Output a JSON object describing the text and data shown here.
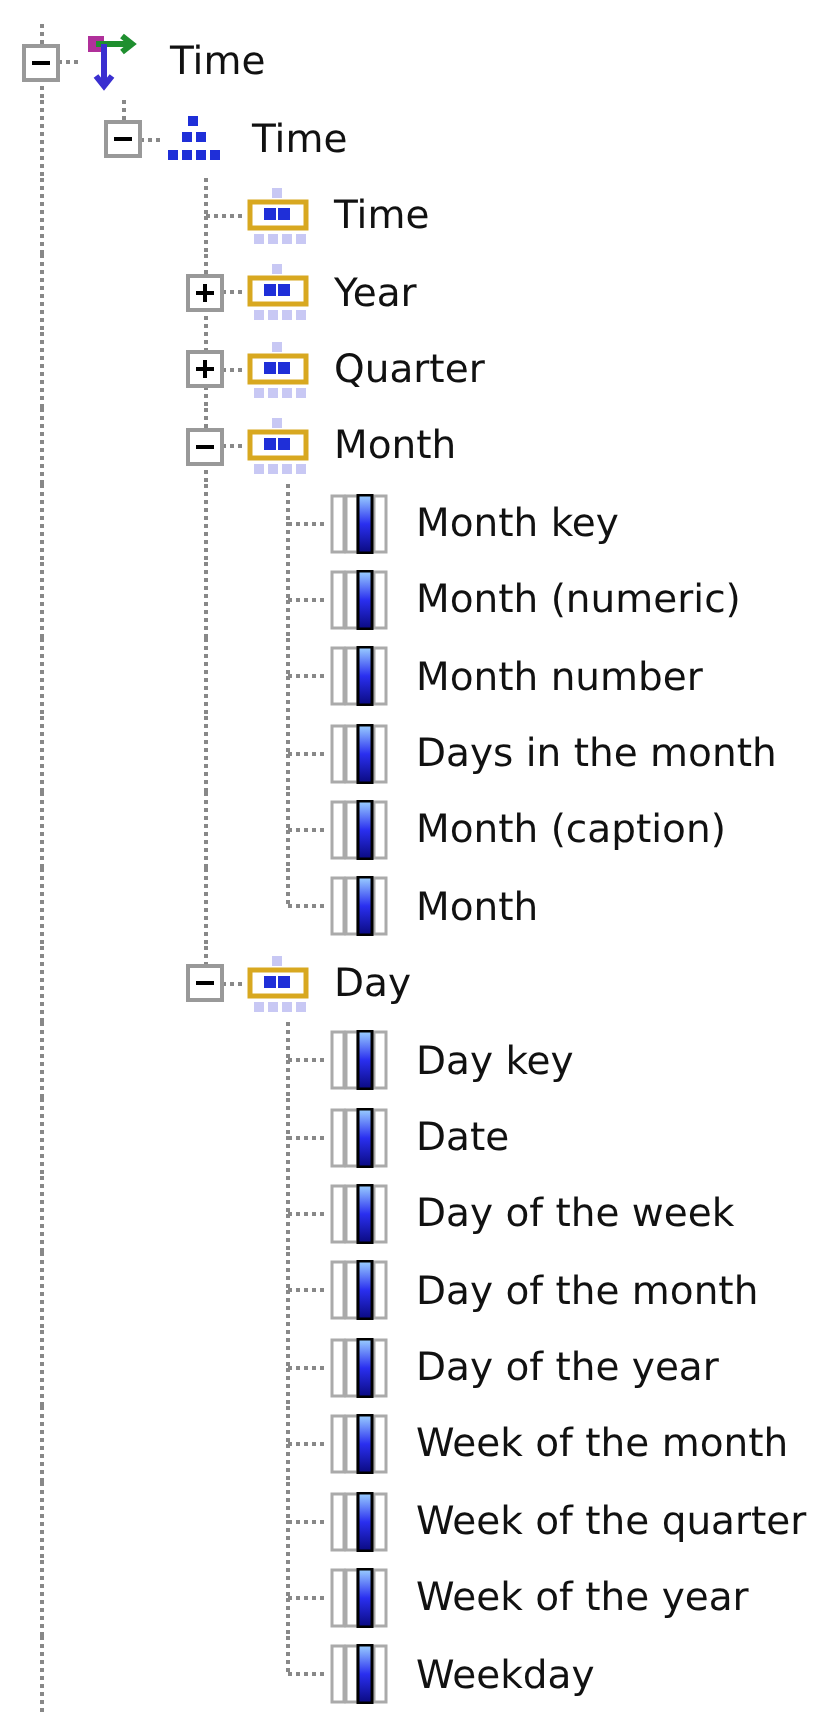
{
  "tree": [
    {
      "label": "Time",
      "kind": "dimension",
      "expanded": true,
      "children": [
        {
          "label": "Time",
          "kind": "hierarchy",
          "expanded": true,
          "children": [
            {
              "label": "Time",
              "kind": "level"
            },
            {
              "label": "Year",
              "kind": "level",
              "expanded": false
            },
            {
              "label": "Quarter",
              "kind": "level",
              "expanded": false
            },
            {
              "label": "Month",
              "kind": "level",
              "expanded": true,
              "children": [
                {
                  "label": "Month key",
                  "kind": "attribute"
                },
                {
                  "label": "Month (numeric)",
                  "kind": "attribute"
                },
                {
                  "label": "Month number",
                  "kind": "attribute"
                },
                {
                  "label": "Days in the month",
                  "kind": "attribute"
                },
                {
                  "label": "Month (caption)",
                  "kind": "attribute"
                },
                {
                  "label": "Month",
                  "kind": "attribute"
                }
              ]
            },
            {
              "label": "Day",
              "kind": "level",
              "expanded": true,
              "children": [
                {
                  "label": "Day key",
                  "kind": "attribute"
                },
                {
                  "label": "Date",
                  "kind": "attribute"
                },
                {
                  "label": "Day of the week",
                  "kind": "attribute"
                },
                {
                  "label": "Day of the month",
                  "kind": "attribute"
                },
                {
                  "label": "Day of the year",
                  "kind": "attribute"
                },
                {
                  "label": "Week of the month",
                  "kind": "attribute"
                },
                {
                  "label": "Week of the quarter",
                  "kind": "attribute"
                },
                {
                  "label": "Week of the year",
                  "kind": "attribute"
                },
                {
                  "label": "Weekday",
                  "kind": "attribute"
                }
              ]
            }
          ]
        }
      ]
    }
  ]
}
